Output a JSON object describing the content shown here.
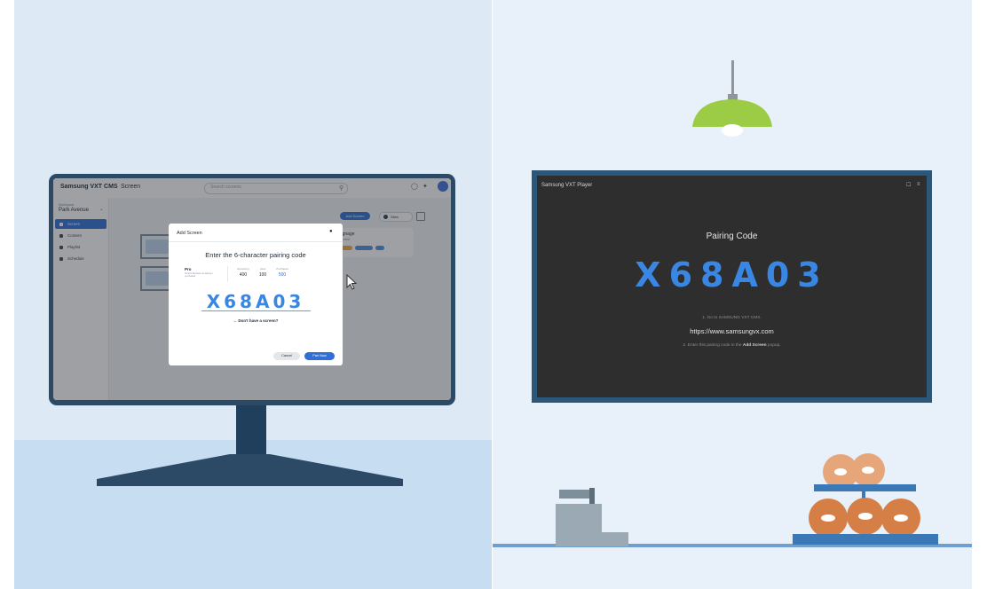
{
  "cms": {
    "app_name": "Samsung VXT CMS",
    "section_title": "Screen",
    "search_placeholder": "Search screens",
    "workspace_label": "Workspace",
    "workspace_name": "Park Avenue",
    "nav": [
      {
        "label": "Screen",
        "active": true
      },
      {
        "label": "Content",
        "active": false
      },
      {
        "label": "Playlist",
        "active": false
      },
      {
        "label": "Schedule",
        "active": false
      }
    ],
    "add_screen_button": "Add Screen",
    "filter_label": "Sites",
    "card_title": "h Signage",
    "card_subtitle": "Connected"
  },
  "modal": {
    "title": "Add Screen",
    "heading": "Enter the 6-character pairing code",
    "plan_name": "Pro",
    "plan_description": "Screen licenses remaining / purchased",
    "stats": [
      {
        "label": "Remaining",
        "value": "400"
      },
      {
        "label": "Used",
        "value": "100"
      },
      {
        "label": "Purchased",
        "value": "500"
      }
    ],
    "pairing_code": "X68A03",
    "no_screen_link": "Don't have a screen?",
    "cancel_label": "Cancel",
    "pair_label": "Pair Now"
  },
  "player": {
    "app_name": "Samsung VXT Player",
    "pairing_label": "Pairing Code",
    "pairing_code": "X68A03",
    "step1": "1. Go to SAMSUNG VXT CMS.",
    "url": "https://www.samsungvx.com",
    "step2_prefix": "2. Enter this pairing code in the ",
    "step2_bold": "Add Screen",
    "step2_suffix": " popup."
  },
  "colors": {
    "accent_blue": "#3a86e3",
    "button_blue": "#2f6fd6",
    "monitor_frame": "#2c4a66",
    "tv_frame": "#2b5878",
    "tv_bg": "#2e2e2f"
  }
}
